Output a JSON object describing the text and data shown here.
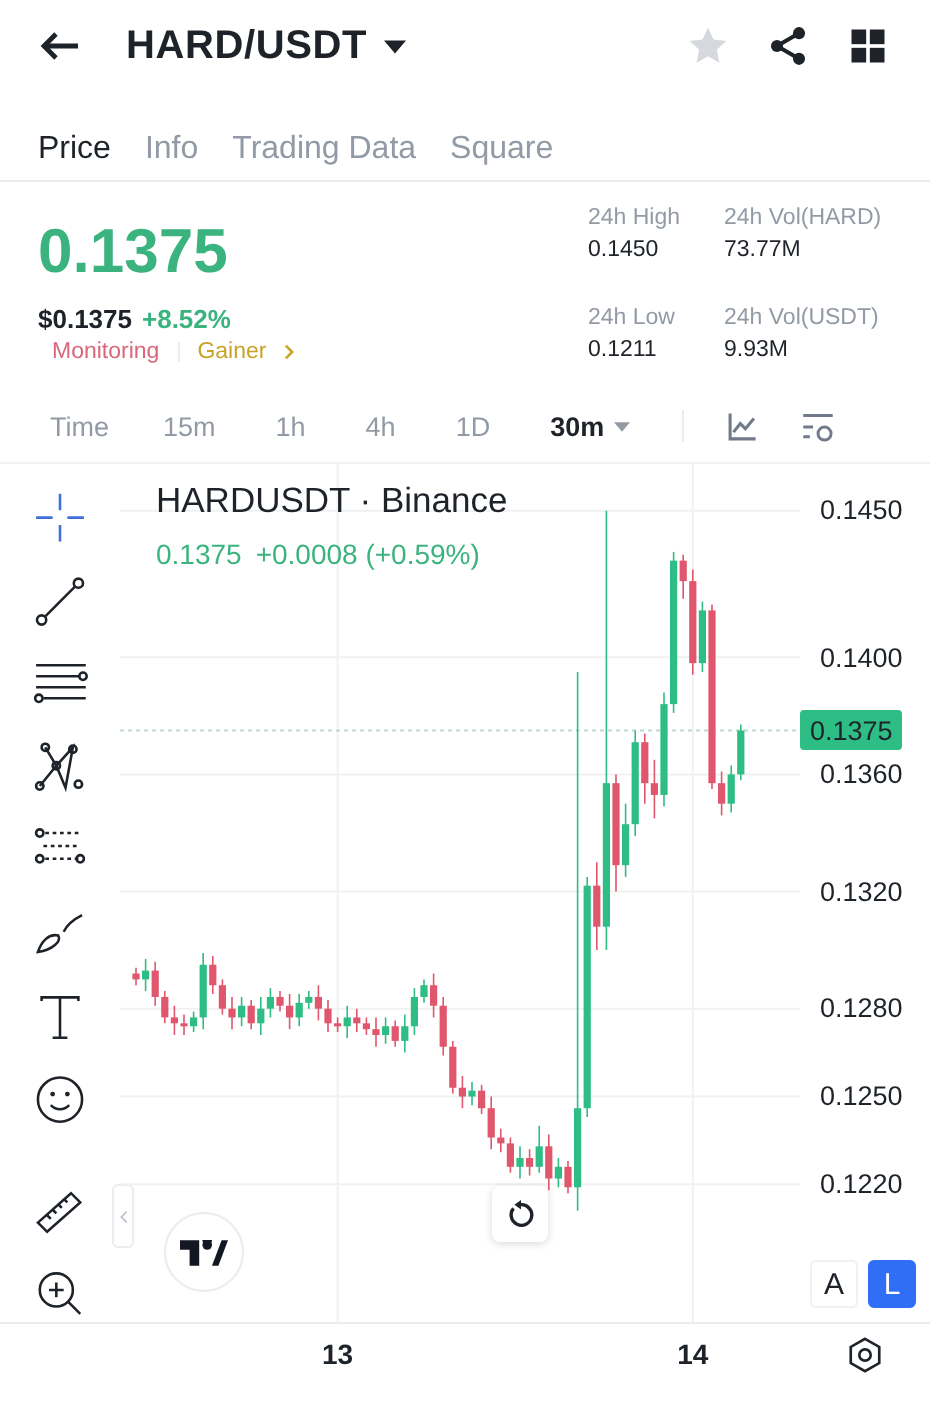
{
  "header": {
    "title": "HARD/USDT",
    "favorite": false
  },
  "tabs": [
    {
      "label": "Price",
      "selected": true
    },
    {
      "label": "Info",
      "selected": false
    },
    {
      "label": "Trading Data",
      "selected": false
    },
    {
      "label": "Square",
      "selected": false
    }
  ],
  "ticker": {
    "price": "0.1375",
    "usd_price": "$0.1375",
    "change": "+8.52%",
    "tags": [
      {
        "label": "Monitoring",
        "color": "#d9677a"
      },
      {
        "label": "Gainer",
        "color": "#c9a227"
      }
    ],
    "stats": [
      {
        "label": "24h High",
        "value": "0.1450"
      },
      {
        "label": "24h Vol(HARD)",
        "value": "73.77M"
      },
      {
        "label": "24h Low",
        "value": "0.1211"
      },
      {
        "label": "24h Vol(USDT)",
        "value": "9.93M"
      }
    ]
  },
  "intervals": [
    {
      "label": "Time",
      "selected": false
    },
    {
      "label": "15m",
      "selected": false
    },
    {
      "label": "1h",
      "selected": false
    },
    {
      "label": "4h",
      "selected": false
    },
    {
      "label": "1D",
      "selected": false
    },
    {
      "label": "30m",
      "selected": true
    }
  ],
  "chart": {
    "symbol": "HARDUSDT · Binance",
    "last": "0.1375",
    "change": "+0.0008 (+0.59%)",
    "chart_data": {
      "type": "candlestick",
      "categories": [
        null,
        null,
        null,
        null,
        null,
        null,
        null,
        null,
        null,
        null,
        null,
        null,
        null,
        null,
        null,
        null,
        null,
        null,
        null,
        null,
        null,
        "13",
        null,
        null,
        null,
        null,
        null,
        null,
        null,
        null,
        null,
        null,
        null,
        null,
        null,
        null,
        null,
        null,
        null,
        null,
        null,
        null,
        null,
        null,
        null,
        null,
        null,
        null,
        null,
        null,
        null,
        null,
        null,
        null,
        null,
        null,
        null,
        null,
        "14",
        null,
        null,
        null,
        null,
        null
      ],
      "ylim": [
        0.1173,
        0.1466
      ],
      "ohlc": [
        [
          0.1292,
          0.1294,
          0.1288,
          0.129
        ],
        [
          0.129,
          0.1297,
          0.1286,
          0.1293
        ],
        [
          0.1293,
          0.1296,
          0.1281,
          0.1284
        ],
        [
          0.1284,
          0.1286,
          0.1275,
          0.1277
        ],
        [
          0.1277,
          0.1281,
          0.1271,
          0.1275
        ],
        [
          0.1275,
          0.1278,
          0.1271,
          0.1274
        ],
        [
          0.1274,
          0.1279,
          0.1272,
          0.1277
        ],
        [
          0.1277,
          0.1299,
          0.1273,
          0.1295
        ],
        [
          0.1295,
          0.1298,
          0.1285,
          0.1288
        ],
        [
          0.1288,
          0.129,
          0.1278,
          0.128
        ],
        [
          0.128,
          0.1284,
          0.1273,
          0.1277
        ],
        [
          0.1277,
          0.1284,
          0.1274,
          0.1281
        ],
        [
          0.1281,
          0.1283,
          0.1273,
          0.1275
        ],
        [
          0.1275,
          0.1284,
          0.1271,
          0.128
        ],
        [
          0.128,
          0.1287,
          0.1277,
          0.1284
        ],
        [
          0.1284,
          0.1286,
          0.1279,
          0.1281
        ],
        [
          0.1281,
          0.1285,
          0.1273,
          0.1277
        ],
        [
          0.1277,
          0.1285,
          0.1274,
          0.1282
        ],
        [
          0.1282,
          0.1286,
          0.128,
          0.1284
        ],
        [
          0.1284,
          0.1288,
          0.1276,
          0.128
        ],
        [
          0.128,
          0.1283,
          0.1272,
          0.1275
        ],
        [
          0.1275,
          0.1277,
          0.1272,
          0.1274
        ],
        [
          0.1274,
          0.1281,
          0.127,
          0.1277
        ],
        [
          0.1277,
          0.128,
          0.1272,
          0.1275
        ],
        [
          0.1275,
          0.1277,
          0.1271,
          0.1273
        ],
        [
          0.1273,
          0.1277,
          0.1267,
          0.1271
        ],
        [
          0.1271,
          0.1277,
          0.1268,
          0.1274
        ],
        [
          0.1274,
          0.1276,
          0.1267,
          0.1269
        ],
        [
          0.1269,
          0.1278,
          0.1265,
          0.1274
        ],
        [
          0.1274,
          0.1287,
          0.1271,
          0.1284
        ],
        [
          0.1284,
          0.129,
          0.1282,
          0.1288
        ],
        [
          0.1288,
          0.1292,
          0.1277,
          0.1281
        ],
        [
          0.1281,
          0.1284,
          0.1264,
          0.1267
        ],
        [
          0.1267,
          0.1269,
          0.1251,
          0.1253
        ],
        [
          0.1253,
          0.1257,
          0.1246,
          0.125
        ],
        [
          0.125,
          0.1255,
          0.1247,
          0.1252
        ],
        [
          0.1252,
          0.1254,
          0.1244,
          0.1246
        ],
        [
          0.1246,
          0.125,
          0.1232,
          0.1236
        ],
        [
          0.1236,
          0.1239,
          0.1231,
          0.1234
        ],
        [
          0.1234,
          0.1236,
          0.1224,
          0.1226
        ],
        [
          0.1226,
          0.1233,
          0.1222,
          0.1229
        ],
        [
          0.1229,
          0.1232,
          0.1223,
          0.1226
        ],
        [
          0.1226,
          0.124,
          0.1224,
          0.1233
        ],
        [
          0.1233,
          0.1237,
          0.1218,
          0.1222
        ],
        [
          0.1222,
          0.1229,
          0.1219,
          0.1226
        ],
        [
          0.1226,
          0.1228,
          0.1217,
          0.1219
        ],
        [
          0.1219,
          0.1395,
          0.1211,
          0.1246
        ],
        [
          0.1246,
          0.1325,
          0.1243,
          0.1322
        ],
        [
          0.1322,
          0.133,
          0.13,
          0.1308
        ],
        [
          0.1308,
          0.145,
          0.13,
          0.1357
        ],
        [
          0.1357,
          0.136,
          0.132,
          0.1329
        ],
        [
          0.1329,
          0.135,
          0.1325,
          0.1343
        ],
        [
          0.1343,
          0.1375,
          0.1339,
          0.1371
        ],
        [
          0.1371,
          0.1374,
          0.135,
          0.1357
        ],
        [
          0.1357,
          0.1365,
          0.1345,
          0.1353
        ],
        [
          0.1353,
          0.1388,
          0.1349,
          0.1384
        ],
        [
          0.1384,
          0.1436,
          0.1381,
          0.1433
        ],
        [
          0.1433,
          0.1435,
          0.142,
          0.1426
        ],
        [
          0.1426,
          0.143,
          0.1394,
          0.1398
        ],
        [
          0.1398,
          0.1419,
          0.1395,
          0.1416
        ],
        [
          0.1416,
          0.1418,
          0.1355,
          0.1357
        ],
        [
          0.1357,
          0.1361,
          0.1346,
          0.135
        ],
        [
          0.135,
          0.1363,
          0.1347,
          0.136
        ],
        [
          0.136,
          0.1377,
          0.1358,
          0.1375
        ]
      ],
      "yticks": [
        {
          "value": 0.145,
          "label": "0.1450"
        },
        {
          "value": 0.14,
          "label": "0.1400"
        },
        {
          "value": 0.136,
          "label": "0.1360"
        },
        {
          "value": 0.132,
          "label": "0.1320"
        },
        {
          "value": 0.128,
          "label": "0.1280"
        },
        {
          "value": 0.125,
          "label": "0.1250"
        },
        {
          "value": 0.122,
          "label": "0.1220"
        }
      ],
      "grid": true,
      "ref_lines": [
        {
          "axis": "y",
          "value": 0.1375
        }
      ]
    },
    "current_price": "0.1375",
    "scale_modes": [
      {
        "label": "A",
        "selected": false
      },
      {
        "label": "L",
        "selected": true
      }
    ]
  }
}
